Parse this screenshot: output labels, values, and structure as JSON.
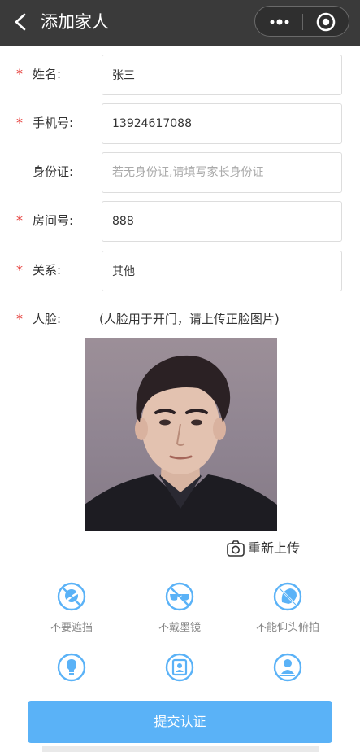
{
  "nav": {
    "title": "添加家人"
  },
  "form": {
    "required_mark": "*",
    "fields": [
      {
        "label": "姓名:",
        "value": "张三",
        "placeholder": "",
        "required": true
      },
      {
        "label": "手机号:",
        "value": "13924617088",
        "placeholder": "",
        "required": true
      },
      {
        "label": "身份证:",
        "value": "",
        "placeholder": "若无身份证,请填写家长身份证",
        "required": false
      },
      {
        "label": "房间号:",
        "value": "888",
        "placeholder": "",
        "required": true
      },
      {
        "label": "关系:",
        "value": "其他",
        "placeholder": "",
        "required": true
      }
    ],
    "face": {
      "label": "人脸:",
      "hint": "(人脸用于开门，请上传正脸图片)"
    }
  },
  "reupload_label": "重新上传",
  "tips": [
    {
      "icon": "no-cover-icon",
      "caption": "不要遮挡"
    },
    {
      "icon": "no-sunglasses-icon",
      "caption": "不戴墨镜"
    },
    {
      "icon": "no-tilt-head-icon",
      "caption": "不能仰头俯拍"
    },
    {
      "icon": "lighting-icon",
      "caption": ""
    },
    {
      "icon": "portrait-card-icon",
      "caption": ""
    },
    {
      "icon": "face-person-icon",
      "caption": ""
    }
  ],
  "submit_label": "提交认证",
  "colors": {
    "nav_bg": "#3a3a3a",
    "accent": "#5ab2f7",
    "required": "#e53935"
  }
}
